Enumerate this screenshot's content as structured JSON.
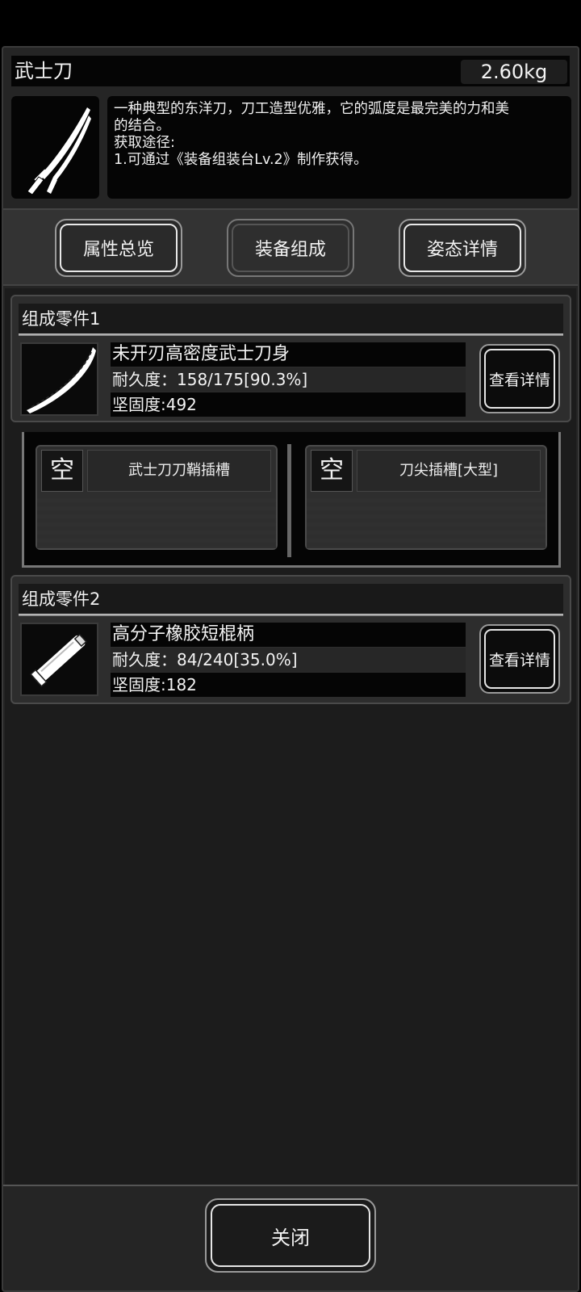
{
  "item": {
    "name": "武士刀",
    "weight": "2.60kg",
    "icon": "katana-icon",
    "description_lines": [
      "一种典型的东洋刀，刀工造型优雅，它的弧度是最完美的力和美",
      "的结合。",
      "获取途径:",
      "1.可通过《装备组装台Lv.2》制作获得。"
    ]
  },
  "tabs": [
    {
      "label": "属性总览"
    },
    {
      "label": "装备组成"
    },
    {
      "label": "姿态详情"
    }
  ],
  "components": [
    {
      "header": "组成零件1",
      "icon": "blade-icon",
      "name": "未开刃高密度武士刀身",
      "durability": "耐久度：158/175[90.3%]",
      "durability_fraction": 0.903,
      "hardness": "坚固度:492",
      "detail_label": "查看详情"
    },
    {
      "header": "组成零件2",
      "icon": "handle-icon",
      "name": "高分子橡胶短棍柄",
      "durability": "耐久度：84/240[35.0%]",
      "durability_fraction": 0.35,
      "hardness": "坚固度:182",
      "detail_label": "查看详情"
    }
  ],
  "slots": [
    {
      "state": "空",
      "label": "武士刀刀鞘插槽"
    },
    {
      "state": "空",
      "label": "刀尖插槽[大型]"
    }
  ],
  "footer": {
    "close_label": "关闭"
  }
}
